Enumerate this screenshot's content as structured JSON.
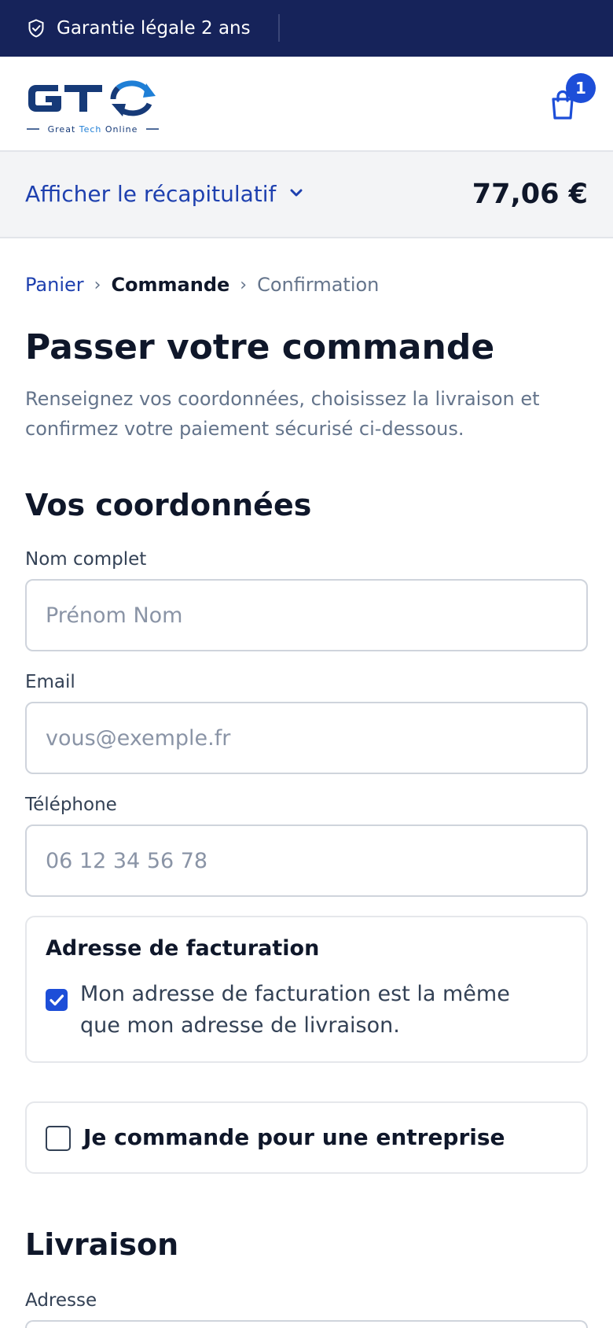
{
  "topbar": {
    "guarantee": "Garantie légale 2 ans",
    "bg_color": "#16235a",
    "icon": "shield-check-icon"
  },
  "header": {
    "logo_letters": "GTO",
    "logo_tagline": "Great Tech Online",
    "cart_icon": "shopping-bag-icon",
    "cart_count": "1",
    "accent": "#1d4ed8"
  },
  "summary": {
    "toggle_label": "Afficher le récapitulatif",
    "total": "77,06 €"
  },
  "breadcrumb": {
    "step1": "Panier",
    "separator": "›",
    "step2": "Commande",
    "step3": "Confirmation"
  },
  "page": {
    "title": "Passer votre commande",
    "intro": "Renseignez vos coordonnées, choisissez la livraison et confirmez votre paiement sécurisé ci-dessous."
  },
  "contact": {
    "heading": "Vos coordonnées",
    "name_label": "Nom complet",
    "name_placeholder": "Prénom Nom",
    "email_label": "Email",
    "email_placeholder": "vous@exemple.fr",
    "phone_label": "Téléphone",
    "phone_placeholder": "06 12 34 56 78"
  },
  "billing": {
    "heading": "Adresse de facturation",
    "same_checked": true,
    "same_label_line1": "Mon adresse de facturation est la même",
    "same_label_line2": "que mon adresse de livraison."
  },
  "business": {
    "checked": false,
    "label": "Je commande pour une entreprise"
  },
  "delivery": {
    "heading": "Livraison",
    "address_label": "Adresse"
  }
}
